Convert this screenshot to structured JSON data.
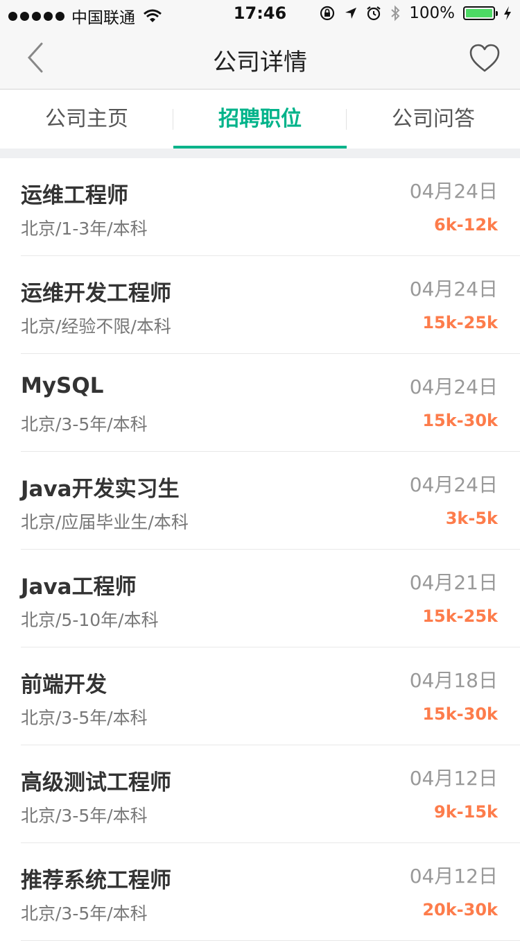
{
  "status_bar": {
    "carrier": "中国联通",
    "time": "17:46",
    "battery": "100%",
    "battery_level": 1.0
  },
  "nav": {
    "title": "公司详情",
    "back_icon": "chevron-left-icon",
    "favorite_icon": "heart-outline-icon"
  },
  "tabs": [
    {
      "label": "公司主页",
      "active": false
    },
    {
      "label": "招聘职位",
      "active": true
    },
    {
      "label": "公司问答",
      "active": false
    }
  ],
  "colors": {
    "accent": "#00b38a",
    "salary": "#fd7c4b",
    "battery": "#4cd964"
  },
  "jobs": [
    {
      "title": "运维工程师",
      "meta": "北京/1-3年/本科",
      "date": "04月24日",
      "salary": "6k-12k"
    },
    {
      "title": "运维开发工程师",
      "meta": "北京/经验不限/本科",
      "date": "04月24日",
      "salary": "15k-25k"
    },
    {
      "title": "MySQL",
      "meta": "北京/3-5年/本科",
      "date": "04月24日",
      "salary": "15k-30k"
    },
    {
      "title": "Java开发实习生",
      "meta": "北京/应届毕业生/本科",
      "date": "04月24日",
      "salary": "3k-5k"
    },
    {
      "title": "Java工程师",
      "meta": "北京/5-10年/本科",
      "date": "04月21日",
      "salary": "15k-25k"
    },
    {
      "title": "前端开发",
      "meta": "北京/3-5年/本科",
      "date": "04月18日",
      "salary": "15k-30k"
    },
    {
      "title": "高级测试工程师",
      "meta": "北京/3-5年/本科",
      "date": "04月12日",
      "salary": "9k-15k"
    },
    {
      "title": "推荐系统工程师",
      "meta": "北京/3-5年/本科",
      "date": "04月12日",
      "salary": "20k-30k"
    }
  ]
}
